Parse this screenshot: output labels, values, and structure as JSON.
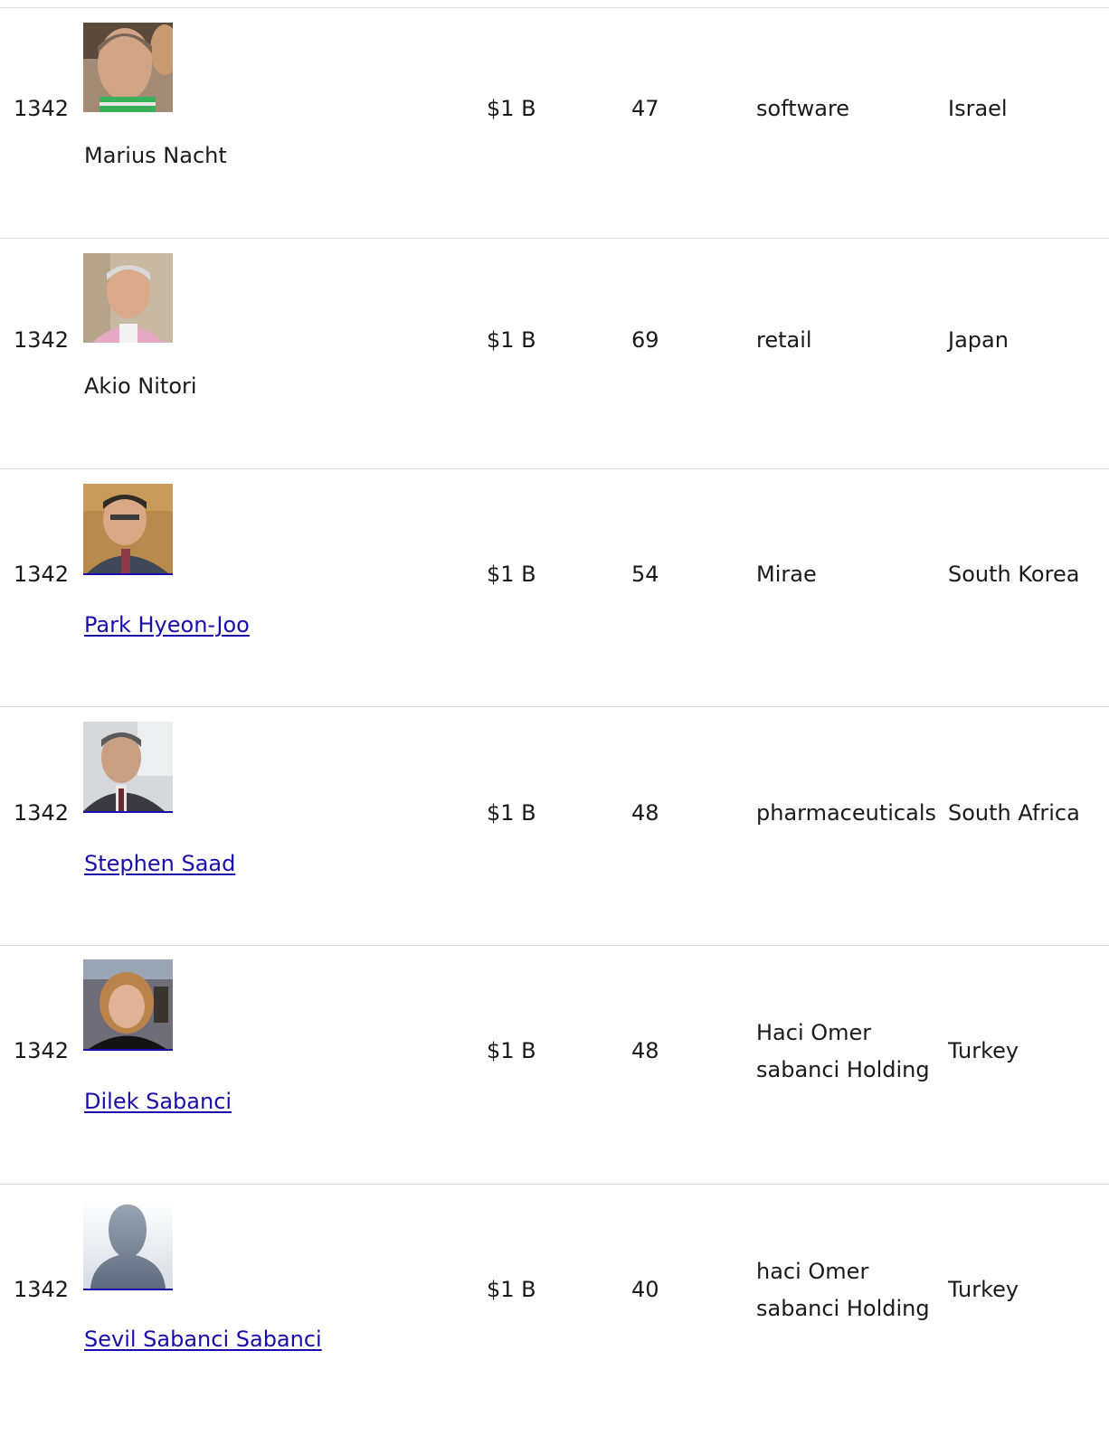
{
  "rows": [
    {
      "rank": "1342",
      "name": "Marius Nacht",
      "photo_icon": "person-photo",
      "net_worth": "$1 B",
      "age": "47",
      "source": "software",
      "country": "Israel",
      "linked": false
    },
    {
      "rank": "1342",
      "name": "Akio Nitori",
      "photo_icon": "person-photo",
      "net_worth": "$1 B",
      "age": "69",
      "source": "retail",
      "country": "Japan",
      "linked": false
    },
    {
      "rank": "1342",
      "name": "Park Hyeon-Joo",
      "photo_icon": "person-photo",
      "net_worth": "$1 B",
      "age": "54",
      "source": "Mirae",
      "country": "South Korea",
      "linked": true
    },
    {
      "rank": "1342",
      "name": "Stephen Saad",
      "photo_icon": "person-photo",
      "net_worth": "$1 B",
      "age": "48",
      "source": "pharmaceuticals",
      "country": "South Africa",
      "linked": true
    },
    {
      "rank": "1342",
      "name": "Dilek Sabanci",
      "photo_icon": "person-photo",
      "net_worth": "$1 B",
      "age": "48",
      "source": "Haci Omer sabanci Holding",
      "country": "Turkey",
      "linked": true
    },
    {
      "rank": "1342",
      "name": "Sevil Sabanci Sabanci",
      "photo_icon": "placeholder-silhouette-icon",
      "net_worth": "$1 B",
      "age": "40",
      "source": "haci Omer sabanci Holding",
      "country": "Turkey",
      "linked": true
    }
  ],
  "colors": {
    "link": "#1a0dab",
    "divider": "#dcdcdc",
    "text": "#1a1a1a"
  }
}
